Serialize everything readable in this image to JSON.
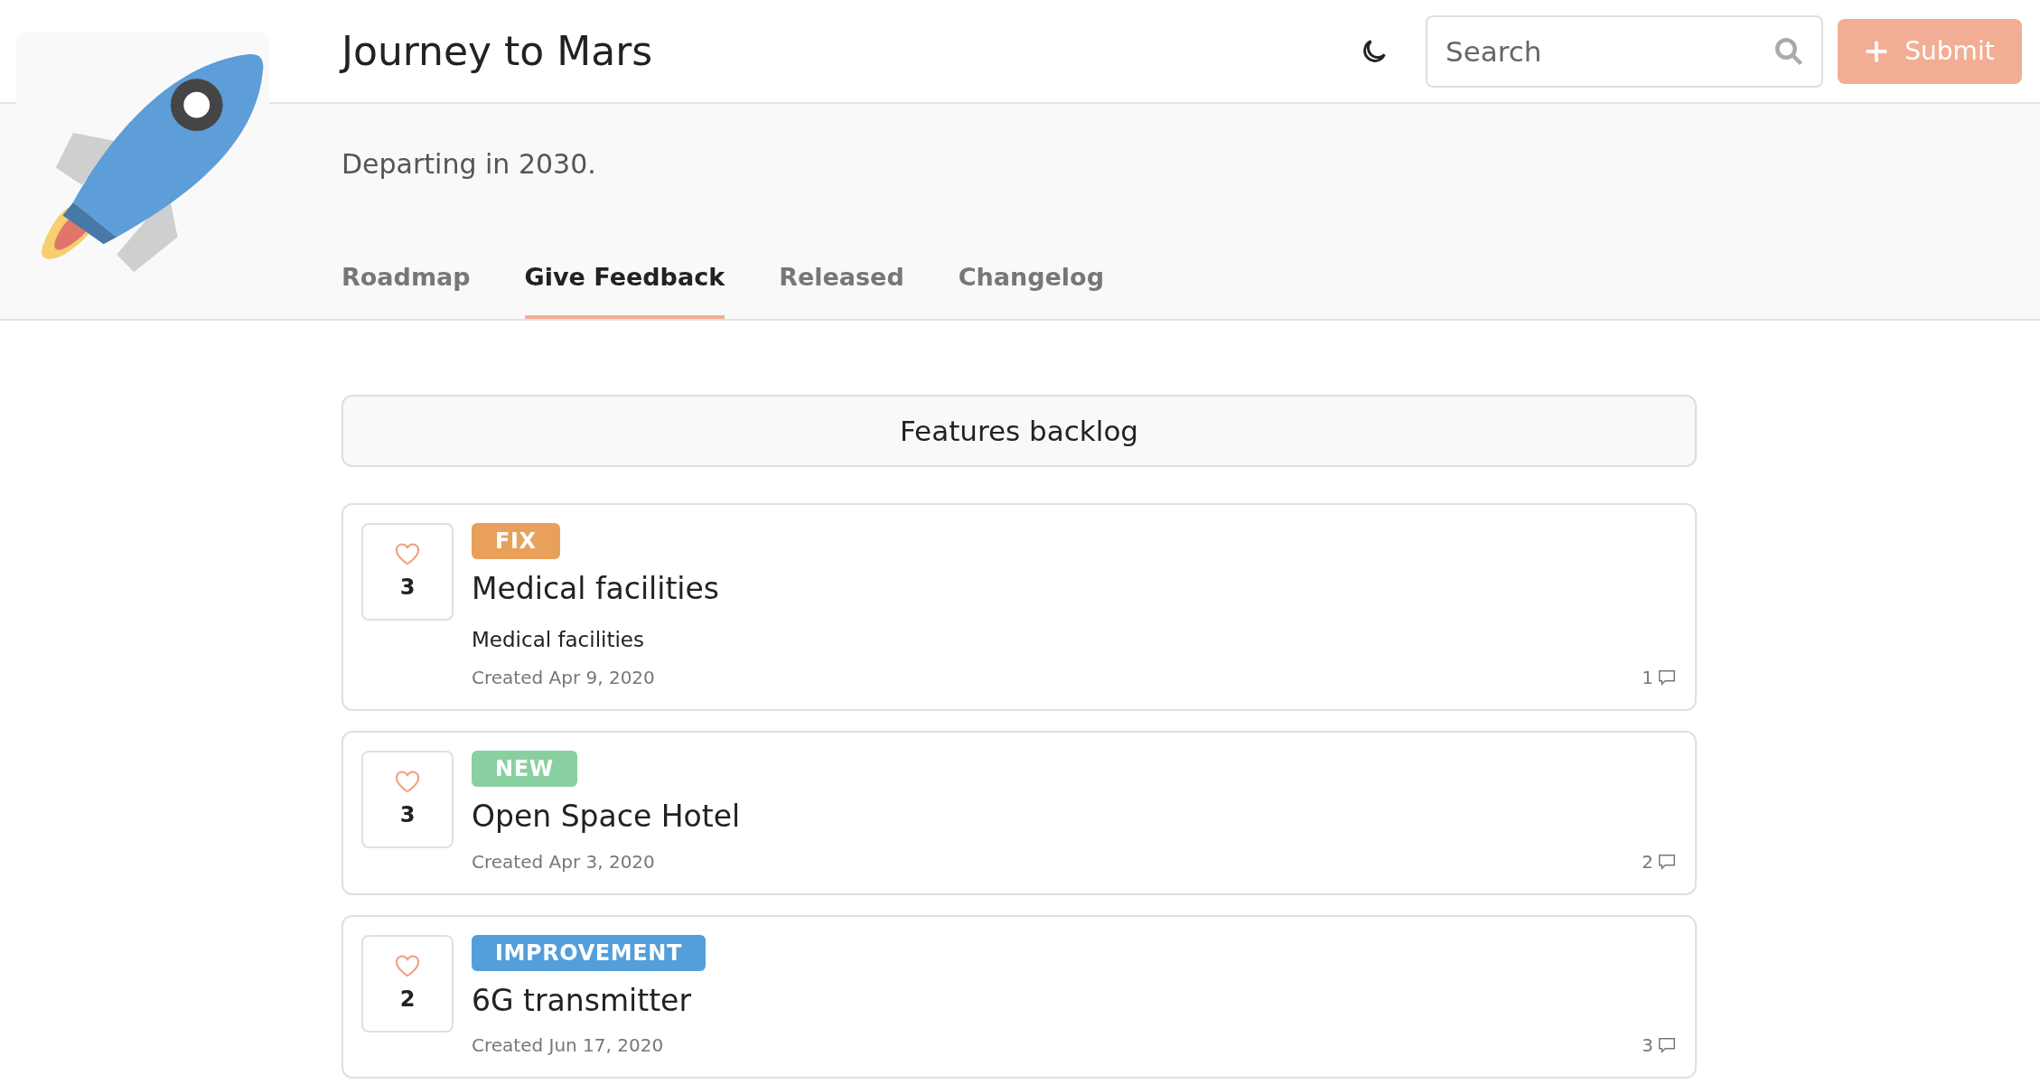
{
  "header": {
    "title": "Journey to Mars",
    "search": {
      "placeholder": "Search"
    },
    "submit": "Submit"
  },
  "subtitle": "Departing in 2030.",
  "tabs": [
    {
      "label": "Roadmap",
      "selected": false
    },
    {
      "label": "Give Feedback",
      "selected": true
    },
    {
      "label": "Released",
      "selected": false
    },
    {
      "label": "Changelog",
      "selected": false
    }
  ],
  "section_title": "Features backlog",
  "posts": [
    {
      "votes": "3",
      "tag": "FIX",
      "color": "#e8a05a",
      "title": "Medical facilities",
      "description": "Medical facilities",
      "created": "Created Apr 9, 2020",
      "comments": "1"
    },
    {
      "votes": "3",
      "tag": "NEW",
      "color": "#88d0a0",
      "title": "Open Space Hotel",
      "created": "Created Apr 3, 2020",
      "comments": "2"
    },
    {
      "votes": "2",
      "tag": "IMPROVEMENT",
      "color": "#529fdc",
      "title": "6G transmitter",
      "created": "Created Jun 17, 2020",
      "comments": "3"
    }
  ]
}
